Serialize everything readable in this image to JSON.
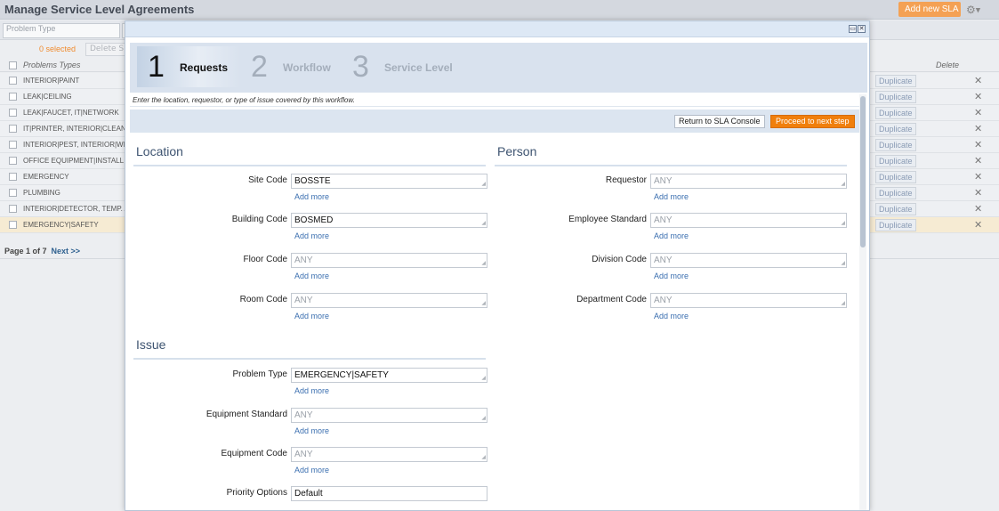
{
  "page": {
    "title": "Manage Service Level Agreements",
    "add_sla_label": "Add new SLA",
    "filter_placeholder": "Problem Type",
    "selected_count": "0 selected",
    "delete_selected_label": "Delete S",
    "column_problem_types": "Problems Types",
    "column_delete": "Delete",
    "rows": [
      {
        "problem_type": "INTERIOR|PAINT",
        "duplicate_label": "Duplicate"
      },
      {
        "problem_type": "LEAK|CEILING",
        "duplicate_label": "Duplicate"
      },
      {
        "problem_type": "LEAK|FAUCET, IT|NETWORK",
        "duplicate_label": "Duplicate"
      },
      {
        "problem_type": "IT|PRINTER, INTERIOR|CLEANING",
        "duplicate_label": "Duplicate"
      },
      {
        "problem_type": "INTERIOR|PEST, INTERIOR|WIND",
        "duplicate_label": "Duplicate"
      },
      {
        "problem_type": "OFFICE EQUIPMENT|INSTALL",
        "duplicate_label": "Duplicate"
      },
      {
        "problem_type": "EMERGENCY",
        "duplicate_label": "Duplicate"
      },
      {
        "problem_type": "PLUMBING",
        "duplicate_label": "Duplicate"
      },
      {
        "problem_type": "INTERIOR|DETECTOR, TEMP. AD",
        "duplicate_label": "Duplicate"
      },
      {
        "problem_type": "EMERGENCY|SAFETY",
        "duplicate_label": "Duplicate"
      }
    ],
    "pager_text": "Page 1 of 7",
    "pager_next": "Next >>"
  },
  "wizard": {
    "steps": [
      {
        "number": "1",
        "label": "Requests"
      },
      {
        "number": "2",
        "label": "Workflow"
      },
      {
        "number": "3",
        "label": "Service Level"
      }
    ],
    "instructions": "Enter the location, requestor, or type of issue covered by this workflow.",
    "return_label": "Return to SLA Console",
    "proceed_label": "Proceed to next step",
    "add_more_label": "Add more",
    "location": {
      "title": "Location",
      "site_code_label": "Site Code",
      "site_code_value": "BOSSTE",
      "building_code_label": "Building Code",
      "building_code_value": "BOSMED",
      "floor_code_label": "Floor Code",
      "floor_code_value": "ANY",
      "room_code_label": "Room Code",
      "room_code_value": "ANY"
    },
    "person": {
      "title": "Person",
      "requestor_label": "Requestor",
      "requestor_value": "ANY",
      "employee_standard_label": "Employee Standard",
      "employee_standard_value": "ANY",
      "division_code_label": "Division Code",
      "division_code_value": "ANY",
      "department_code_label": "Department Code",
      "department_code_value": "ANY"
    },
    "issue": {
      "title": "Issue",
      "problem_type_label": "Problem Type",
      "problem_type_value": "EMERGENCY|SAFETY",
      "equipment_standard_label": "Equipment Standard",
      "equipment_standard_value": "ANY",
      "equipment_code_label": "Equipment Code",
      "equipment_code_value": "ANY",
      "priority_options_label": "Priority Options",
      "priority_options_value": "Default"
    }
  },
  "colors": {
    "accent_orange": "#f07f0c",
    "link_blue": "#3b6fb0",
    "section_blue": "#3e5471"
  }
}
